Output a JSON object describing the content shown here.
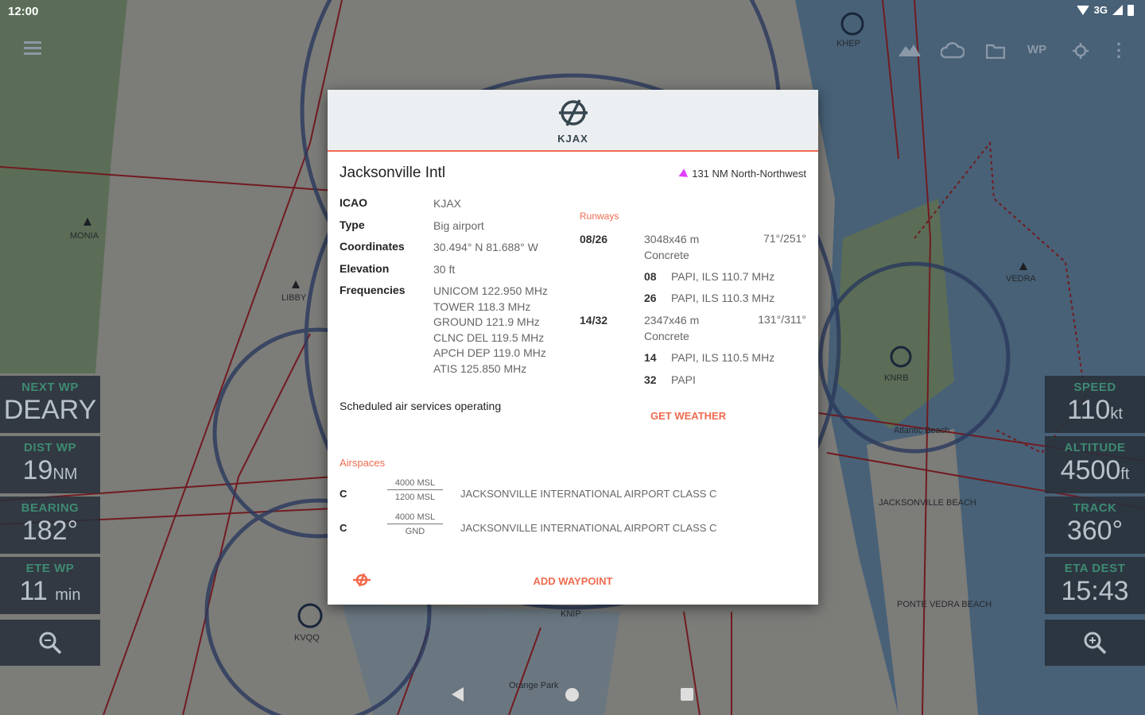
{
  "status_bar": {
    "time": "12:00",
    "network": "3G"
  },
  "toolbar": {
    "wp_label": "WP"
  },
  "map_labels": {
    "monia": "MONIA",
    "libby": "LIBBY",
    "vedra": "VEDRA",
    "knrb": "KNRB",
    "kvqq": "KVQQ",
    "knip": "KNIP",
    "khep": "KHEP",
    "jax_beach": "JACKSONVILLE BEACH",
    "ponte_vedra": "PONTE VEDRA BEACH",
    "atlantic_beach": "Atlantic Beach",
    "orange_park": "Orange Park"
  },
  "left_panels": [
    {
      "label": "NEXT WP",
      "value": "DEARY",
      "unit": ""
    },
    {
      "label": "DIST WP",
      "value": "19",
      "unit": "NM"
    },
    {
      "label": "BEARING",
      "value": "182°",
      "unit": ""
    },
    {
      "label": "ETE WP",
      "value": "11",
      "unit": "min"
    }
  ],
  "right_panels": [
    {
      "label": "SPEED",
      "value": "110",
      "unit": "kt"
    },
    {
      "label": "ALTITUDE",
      "value": "4500",
      "unit": "ft"
    },
    {
      "label": "TRACK",
      "value": "360°",
      "unit": ""
    },
    {
      "label": "ETA DEST",
      "value": "15:43",
      "unit": ""
    }
  ],
  "dialog": {
    "icao_header": "KJAX",
    "name": "Jacksonville Intl",
    "bearing_text": "131 NM North-Northwest",
    "info": {
      "icao_key": "ICAO",
      "icao_val": "KJAX",
      "type_key": "Type",
      "type_val": "Big airport",
      "coords_key": "Coordinates",
      "coords_val": "30.494° N 81.688° W",
      "elev_key": "Elevation",
      "elev_val": "30 ft",
      "freq_key": "Frequencies",
      "frequencies": [
        "UNICOM 122.950 MHz",
        "TOWER 118.3 MHz",
        "GROUND 121.9 MHz",
        "CLNC DEL 119.5 MHz",
        "APCH DEP 119.0 MHz",
        "ATIS 125.850 MHz"
      ]
    },
    "runways_title": "Runways",
    "runways": [
      {
        "id": "08/26",
        "dims": "3048x46 m",
        "surface": "Concrete",
        "heading": "71°/251°",
        "ends": [
          {
            "id": "08",
            "info": "PAPI, ILS 110.7 MHz"
          },
          {
            "id": "26",
            "info": "PAPI, ILS 110.3 MHz"
          }
        ]
      },
      {
        "id": "14/32",
        "dims": "2347x46 m",
        "surface": "Concrete",
        "heading": "131°/311°",
        "ends": [
          {
            "id": "14",
            "info": "PAPI, ILS 110.5 MHz"
          },
          {
            "id": "32",
            "info": "PAPI"
          }
        ]
      }
    ],
    "services": "Scheduled air services operating",
    "get_weather": "GET WEATHER",
    "airspaces_title": "Airspaces",
    "airspaces": [
      {
        "class": "C",
        "upper": "4000 MSL",
        "lower": "1200 MSL",
        "name": "JACKSONVILLE INTERNATIONAL AIRPORT CLASS C"
      },
      {
        "class": "C",
        "upper": "4000 MSL",
        "lower": "GND",
        "name": "JACKSONVILLE INTERNATIONAL AIRPORT CLASS C"
      }
    ],
    "add_waypoint": "ADD WAYPOINT"
  },
  "colors": {
    "accent": "#ef6b4f",
    "panel_label": "#3e8a72",
    "bearing_arrow": "#e040fb"
  }
}
